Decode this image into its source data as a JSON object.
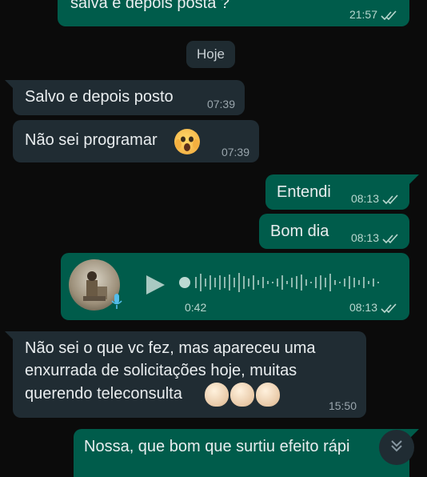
{
  "messages": {
    "m1": {
      "text": "salva e depois posta ?",
      "time": "21:57"
    },
    "date_separator": "Hoje",
    "m2": {
      "text": "Salvo e depois posto",
      "time": "07:39"
    },
    "m3": {
      "text": "Não sei programar",
      "time": "07:39",
      "emoji": "scream-face-icon"
    },
    "m4": {
      "text": "Entendi",
      "time": "08:13"
    },
    "m5": {
      "text": "Bom dia",
      "time": "08:13"
    },
    "voice": {
      "duration": "0:42",
      "time": "08:13"
    },
    "m6": {
      "line1": "Não sei o que vc fez, mas apareceu uma",
      "line2": "enxurrada de solicitações hoje, muitas",
      "line3": "querendo teleconsulta",
      "time": "15:50",
      "emoji": "clapping-hands-icon"
    },
    "m7": {
      "text": "Nossa, que bom que surtiu efeito rápi"
    }
  },
  "colors": {
    "background": "#0b0b0b",
    "outgoing_bubble": "#005c4b",
    "incoming_bubble": "#202c33",
    "read_ticks": "#b9d7cf"
  },
  "icons": {
    "ticks": "double-check-icon",
    "play": "play-icon",
    "mic": "microphone-icon",
    "scroll": "double-chevron-down-icon"
  }
}
